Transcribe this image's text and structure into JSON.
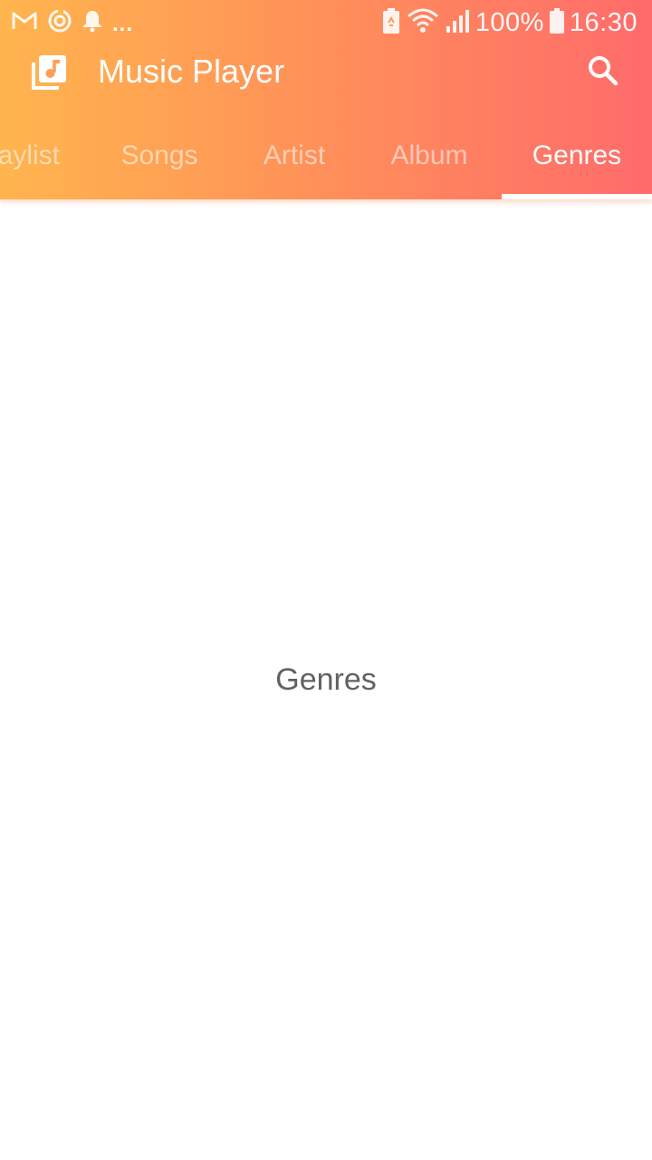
{
  "status_bar": {
    "left_icons": [
      "gmail-icon",
      "sync-icon",
      "bell-icon"
    ],
    "overflow": "...",
    "right_icons": [
      "battery-saver-icon",
      "wifi-icon",
      "signal-icon"
    ],
    "battery_percent": "100%",
    "time": "16:30"
  },
  "toolbar": {
    "title": "Music Player",
    "search_icon": "search-icon",
    "app_icon": "music-library-icon"
  },
  "tabs": {
    "items": [
      {
        "label": "Playlist"
      },
      {
        "label": "Songs"
      },
      {
        "label": "Artist"
      },
      {
        "label": "Album"
      },
      {
        "label": "Genres"
      }
    ],
    "active": "Genres"
  },
  "content": {
    "label": "Genres"
  },
  "colors": {
    "gradient_start": "#ffb54e",
    "gradient_end": "#ff6b6b",
    "text_primary": "#616161"
  }
}
